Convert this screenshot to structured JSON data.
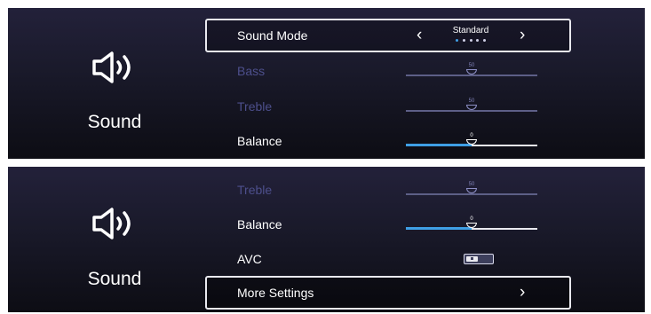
{
  "panel1": {
    "section_title": "Sound",
    "sound_mode": {
      "label": "Sound Mode",
      "value": "Standard",
      "option_count": 5,
      "selected_index": 0
    },
    "bass": {
      "label": "Bass",
      "value": "50"
    },
    "treble": {
      "label": "Treble",
      "value": "50"
    },
    "balance": {
      "label": "Balance",
      "value": "0"
    }
  },
  "panel2": {
    "section_title": "Sound",
    "treble": {
      "label": "Treble",
      "value": "50"
    },
    "balance": {
      "label": "Balance",
      "value": "0"
    },
    "avc": {
      "label": "AVC",
      "state": "off"
    },
    "more_settings": {
      "label": "More Settings"
    }
  },
  "icons": {
    "speaker": "speaker-icon",
    "left_arrow": "chevron-left-icon",
    "right_arrow": "chevron-right-icon"
  },
  "colors": {
    "accent": "#3f9fe5",
    "dim_text": "#4d4f8c",
    "panel_bg": "#1a1a2b"
  }
}
